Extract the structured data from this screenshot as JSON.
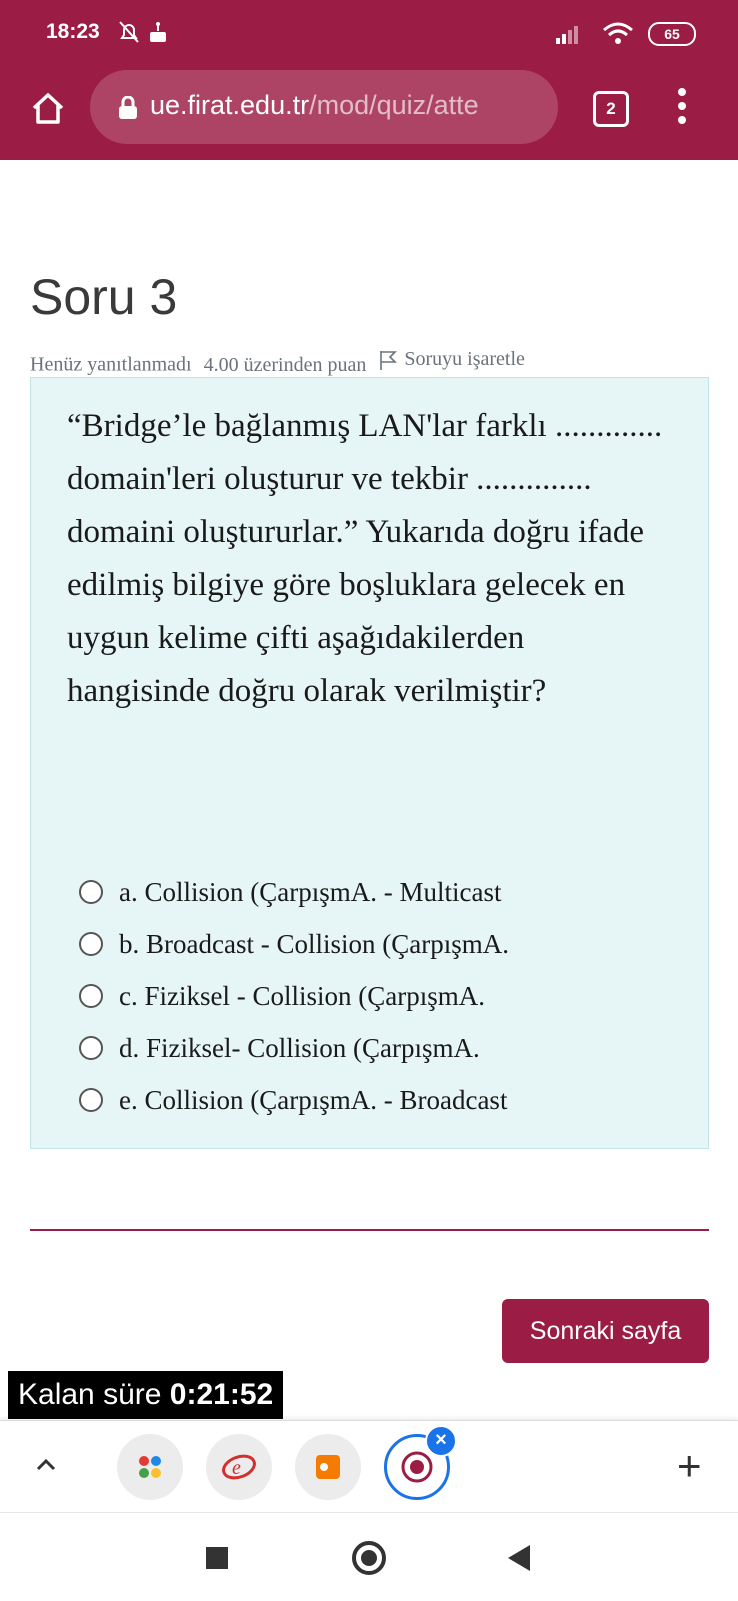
{
  "status_bar": {
    "time": "18:23",
    "battery": "65"
  },
  "browser": {
    "url_domain": "ue.firat.edu.tr",
    "url_path": "/mod/quiz/atte",
    "tab_count": "2"
  },
  "question": {
    "title": "Soru 3",
    "state": "Henüz yanıtlanmadı",
    "grade": "4.00 üzerinden puan",
    "flag_label": "Soruyu işaretle",
    "text": "“Bridge’le bağlanmış LAN'lar farklı ............. domain'leri oluşturur ve tekbir .............. domaini oluştururlar.” Yukarıda doğru ifade edilmiş bilgiye göre boşluklara gelecek en uygun kelime çifti aşağıdakilerden hangisinde doğru olarak verilmiştir?",
    "answers": [
      {
        "label": "a. Collision (ÇarpışmA. - Multicast"
      },
      {
        "label": "b. Broadcast - Collision (ÇarpışmA."
      },
      {
        "label": "c. Fiziksel - Collision (ÇarpışmA."
      },
      {
        "label": "d. Fiziksel- Collision (ÇarpışmA."
      },
      {
        "label": "e. Collision (ÇarpışmA. - Broadcast"
      }
    ]
  },
  "navigation": {
    "next_label": "Sonraki sayfa"
  },
  "timer": {
    "label": "Kalan süre",
    "value": "0:21:52"
  },
  "colors": {
    "brand": "#9b1c44",
    "question_bg": "#e6f5f6",
    "active_tab_ring": "#1a73e8"
  }
}
